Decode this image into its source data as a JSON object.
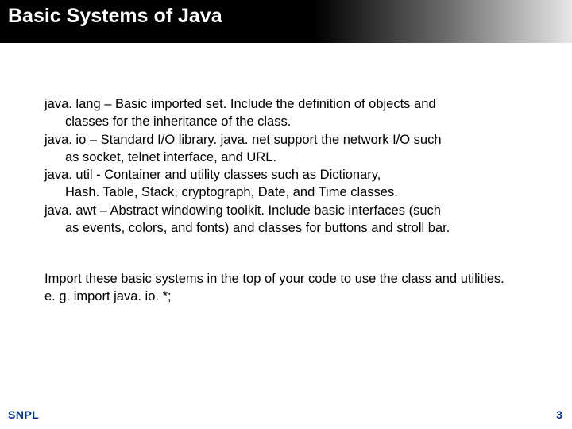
{
  "title": "Basic Systems of Java",
  "entries": [
    {
      "first": "java. lang – Basic imported set. Include the definition of objects and",
      "rest": "classes for the inheritance of the class."
    },
    {
      "first": "java. io – Standard I/O library. java. net support the network I/O such",
      "rest": "as socket, telnet interface, and URL."
    },
    {
      "first": "java. util  - Container and utility classes such as Dictionary,",
      "rest": "Hash. Table, Stack, cryptograph, Date, and Time classes."
    },
    {
      "first": "java. awt – Abstract windowing toolkit. Include basic interfaces (such",
      "rest": "as events, colors, and fonts) and classes for buttons and stroll bar."
    }
  ],
  "summary": {
    "line1": "Import these basic systems in the top of your code to use the class and utilities.",
    "line2": "e. g. import java. io. *;"
  },
  "footer": {
    "left": "SNPL",
    "right": "3"
  }
}
